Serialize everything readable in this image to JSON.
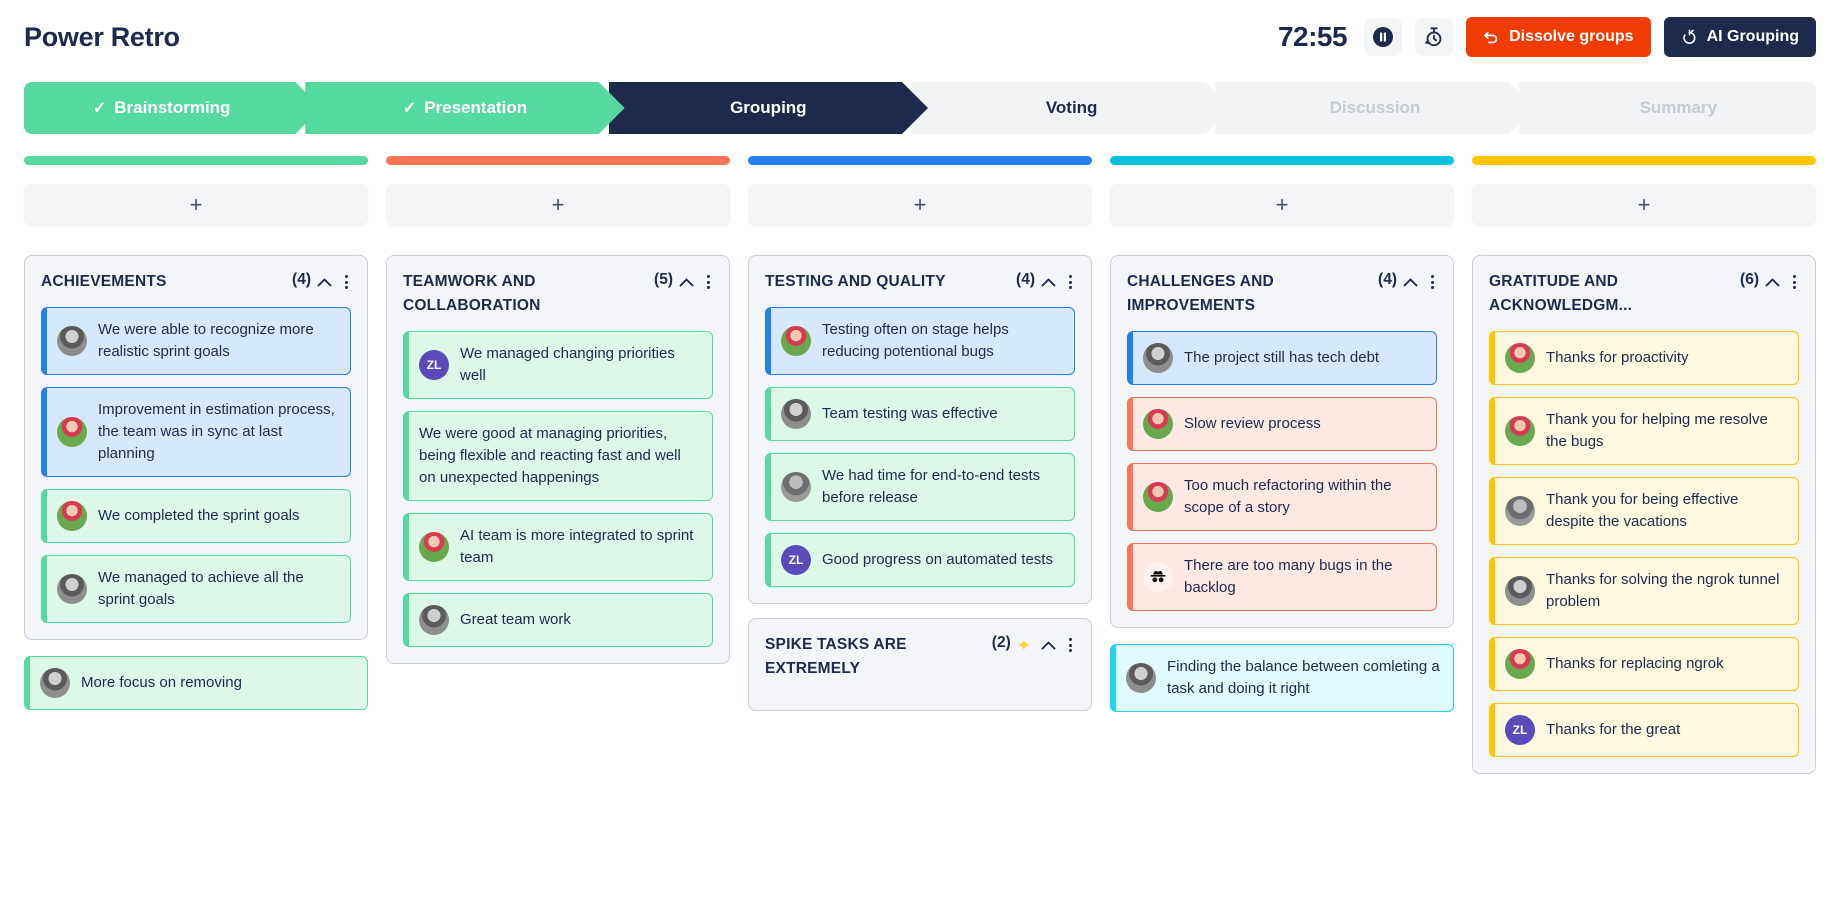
{
  "header": {
    "brand": "Power Retro",
    "timer": "72:55",
    "pause_icon": "pause-icon",
    "restart_icon": "restart-timer-icon",
    "dissolve_label": "Dissolve groups",
    "ai_label": "AI Grouping",
    "dissolve_color": "#f03c02",
    "ai_color": "#1d2a4d"
  },
  "steps": [
    {
      "label": "Brainstorming",
      "state": "done",
      "check": "✓"
    },
    {
      "label": "Presentation",
      "state": "done",
      "check": "✓"
    },
    {
      "label": "Grouping",
      "state": "current",
      "check": ""
    },
    {
      "label": "Voting",
      "state": "next",
      "check": ""
    },
    {
      "label": "Discussion",
      "state": "future",
      "check": ""
    },
    {
      "label": "Summary",
      "state": "future",
      "check": ""
    }
  ],
  "add_label": "+",
  "columns": [
    {
      "bar_color": "#55d9a0",
      "groups": [
        {
          "title": "Achievements",
          "count": "(4)",
          "sparkle": false,
          "notes": [
            {
              "text": "We were able to recognize more realistic sprint goals",
              "color": "blue",
              "avatar": "woman-vintage"
            },
            {
              "text": "Improvement in estimation process, the team was in sync at last planning",
              "color": "blue",
              "avatar": "woman-flowers"
            },
            {
              "text": "We completed the sprint goals",
              "color": "green",
              "avatar": "woman-flowers"
            },
            {
              "text": "We managed to achieve all the sprint goals",
              "color": "green",
              "avatar": "woman-vintage"
            }
          ]
        }
      ],
      "free_notes": [
        {
          "text": "More focus on removing",
          "color": "green",
          "avatar": "woman-vintage"
        }
      ]
    },
    {
      "bar_color": "#fb7453",
      "groups": [
        {
          "title": "Teamwork and collaboration",
          "count": "(5)",
          "sparkle": false,
          "notes": [
            {
              "text": "We managed changing priorities well",
              "color": "green",
              "avatar": "initials",
              "initials": "ZL"
            },
            {
              "text": "We were good at managing priorities, being flexible and reacting fast and well on unexpected happenings",
              "color": "green",
              "avatar": "none"
            },
            {
              "text": "AI team is more integrated to sprint team",
              "color": "green",
              "avatar": "woman-flowers"
            },
            {
              "text": "Great team work",
              "color": "green",
              "avatar": "woman-vintage"
            }
          ]
        }
      ],
      "free_notes": []
    },
    {
      "bar_color": "#2680eb",
      "groups": [
        {
          "title": "Testing and quality",
          "count": "(4)",
          "sparkle": false,
          "notes": [
            {
              "text": "Testing often on stage helps reducing potentional bugs",
              "color": "blue",
              "avatar": "woman-flowers"
            },
            {
              "text": "Team testing was effective",
              "color": "green",
              "avatar": "woman-vintage"
            },
            {
              "text": "We had time for end-to-end tests before release",
              "color": "green",
              "avatar": "man-grey"
            },
            {
              "text": "Good progress on automated tests",
              "color": "green",
              "avatar": "initials",
              "initials": "ZL"
            }
          ]
        },
        {
          "title": "Spike tasks are extremely",
          "count": "(2)",
          "sparkle": true,
          "notes": []
        }
      ],
      "free_notes": []
    },
    {
      "bar_color": "#00c2e0",
      "groups": [
        {
          "title": "Challenges and improvements",
          "count": "(4)",
          "sparkle": false,
          "notes": [
            {
              "text": "The project still has tech debt",
              "color": "blue",
              "avatar": "woman-vintage"
            },
            {
              "text": "Slow review process",
              "color": "red",
              "avatar": "woman-flowers"
            },
            {
              "text": "Too much refactoring within the scope of a story",
              "color": "red",
              "avatar": "woman-flowers"
            },
            {
              "text": "There are too many bugs in the backlog",
              "color": "red",
              "avatar": "anon"
            }
          ]
        }
      ],
      "free_notes": [
        {
          "text": "Finding the balance between comleting a task and doing it right",
          "color": "cyan",
          "avatar": "woman-vintage"
        }
      ]
    },
    {
      "bar_color": "#fdc500",
      "groups": [
        {
          "title": "Gratitude and acknowledgm...",
          "count": "(6)",
          "sparkle": false,
          "notes": [
            {
              "text": "Thanks for proactivity",
              "color": "yellow",
              "avatar": "woman-flowers"
            },
            {
              "text": "Thank you for helping me resolve the bugs",
              "color": "yellow",
              "avatar": "woman-flowers"
            },
            {
              "text": "Thank you for being effective despite the vacations",
              "color": "yellow",
              "avatar": "man-grey"
            },
            {
              "text": "Thanks for solving the ngrok tunnel problem",
              "color": "yellow",
              "avatar": "woman-vintage"
            },
            {
              "text": "Thanks for replacing ngrok",
              "color": "yellow",
              "avatar": "woman-flowers"
            },
            {
              "text": "Thanks for the great",
              "color": "yellow",
              "avatar": "initials",
              "initials": "ZL"
            }
          ]
        }
      ],
      "free_notes": []
    }
  ],
  "note_colors": {
    "blue": {
      "border": "#2680eb",
      "bg": "#d6e8fc"
    },
    "green": {
      "border": "#55d9a0",
      "bg": "#ddf7e9"
    },
    "red": {
      "border": "#fb7453",
      "bg": "#fde9e3"
    },
    "yellow": {
      "border": "#fdc500",
      "bg": "#fdf8e0"
    },
    "cyan": {
      "border": "#22d3ee",
      "bg": "#e0fbff"
    }
  }
}
